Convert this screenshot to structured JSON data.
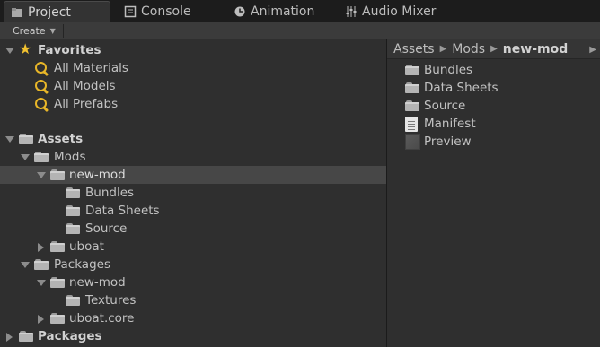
{
  "tabs": [
    {
      "label": "Project",
      "icon": "project-folder-icon",
      "active": true
    },
    {
      "label": "Console",
      "icon": "console-icon",
      "active": false
    },
    {
      "label": "Animation",
      "icon": "animation-clock-icon",
      "active": false
    },
    {
      "label": "Audio Mixer",
      "icon": "audio-mixer-icon",
      "active": false
    }
  ],
  "toolbar": {
    "create_label": "Create",
    "create_caret": "▼"
  },
  "tree": {
    "favorites": {
      "label": "Favorites",
      "items": [
        "All Materials",
        "All Models",
        "All Prefabs"
      ]
    },
    "assets": {
      "label": "Assets",
      "mods": "Mods",
      "new_mod": "new-mod",
      "new_mod_children": [
        "Bundles",
        "Data Sheets",
        "Source"
      ],
      "uboat": "uboat",
      "packages": "Packages",
      "pkg_new_mod": "new-mod",
      "pkg_textures": "Textures",
      "uboat_core": "uboat.core"
    },
    "packages_root": "Packages"
  },
  "breadcrumb": {
    "parts": [
      "Assets",
      "Mods",
      "new-mod"
    ],
    "separator": "▶",
    "more": "▶"
  },
  "content_items": [
    {
      "label": "Bundles",
      "icon": "folder-icon"
    },
    {
      "label": "Data Sheets",
      "icon": "folder-icon"
    },
    {
      "label": "Source",
      "icon": "folder-icon"
    },
    {
      "label": "Manifest",
      "icon": "text-document-icon"
    },
    {
      "label": "Preview",
      "icon": "image-thumbnail-icon"
    }
  ],
  "colors": {
    "background": "#2f2f2f",
    "selection": "#474747",
    "favorites_star": "#f2c230",
    "search_icon": "#e8b628"
  }
}
